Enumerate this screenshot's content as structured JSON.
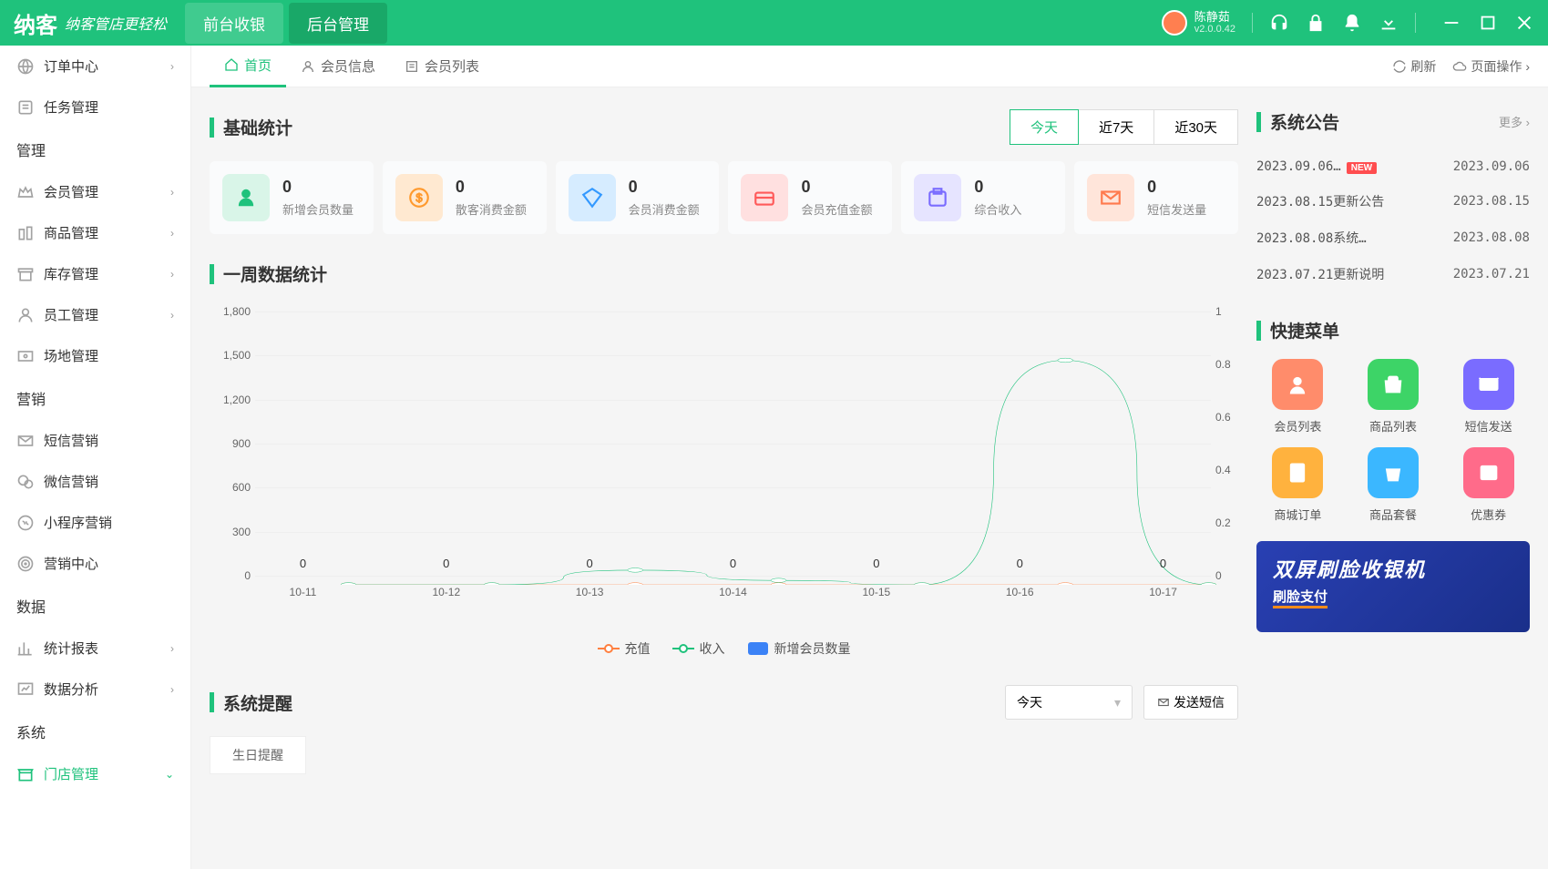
{
  "header": {
    "logo": "纳客",
    "slogan": "纳客管店更轻松",
    "nav1": "前台收银",
    "nav2": "后台管理",
    "user_name": "陈静茹",
    "version": "v2.0.0.42"
  },
  "sidebar": {
    "items": [
      {
        "label": "订单中心",
        "chev": true
      },
      {
        "label": "任务管理"
      }
    ],
    "group1": "管理",
    "items1": [
      {
        "label": "会员管理",
        "chev": true
      },
      {
        "label": "商品管理",
        "chev": true
      },
      {
        "label": "库存管理",
        "chev": true
      },
      {
        "label": "员工管理",
        "chev": true
      },
      {
        "label": "场地管理"
      }
    ],
    "group2": "营销",
    "items2": [
      {
        "label": "短信营销"
      },
      {
        "label": "微信营销"
      },
      {
        "label": "小程序营销"
      },
      {
        "label": "营销中心"
      }
    ],
    "group3": "数据",
    "items3": [
      {
        "label": "统计报表",
        "chev": true
      },
      {
        "label": "数据分析",
        "chev": true
      }
    ],
    "group4": "系统",
    "items4": [
      {
        "label": "门店管理",
        "active": true,
        "chev_down": true
      }
    ]
  },
  "tabs": {
    "home": "首页",
    "member_info": "会员信息",
    "member_list": "会员列表",
    "refresh": "刷新",
    "page_ops": "页面操作"
  },
  "panel1": {
    "title": "基础统计",
    "today": "今天",
    "d7": "近7天",
    "d30": "近30天"
  },
  "stats": [
    {
      "value": "0",
      "label": "新增会员数量",
      "bg": "#d9f5e8",
      "fg": "#1fc27c"
    },
    {
      "value": "0",
      "label": "散客消费金额",
      "bg": "#ffe9d1",
      "fg": "#ff9a2e"
    },
    {
      "value": "0",
      "label": "会员消费金额",
      "bg": "#d6ecff",
      "fg": "#3399ff"
    },
    {
      "value": "0",
      "label": "会员充值金额",
      "bg": "#ffe0e0",
      "fg": "#ff5a5a"
    },
    {
      "value": "0",
      "label": "综合收入",
      "bg": "#e6e4ff",
      "fg": "#7a6cff"
    },
    {
      "value": "0",
      "label": "短信发送量",
      "bg": "#ffe5da",
      "fg": "#ff7a4d"
    }
  ],
  "panel2": {
    "title": "一周数据统计"
  },
  "chart_data": {
    "type": "line",
    "x": [
      "10-11",
      "10-12",
      "10-13",
      "10-14",
      "10-15",
      "10-16",
      "10-17"
    ],
    "series": [
      {
        "name": "充值",
        "values": [
          0,
          0,
          0,
          0,
          0,
          0,
          0
        ],
        "color": "#ff7f3f",
        "axis": "left"
      },
      {
        "name": "收入",
        "values": [
          0,
          0,
          100,
          30,
          0,
          1530,
          0
        ],
        "color": "#1fc27c",
        "axis": "left"
      },
      {
        "name": "新增会员数量",
        "values": [
          0,
          0,
          0,
          0,
          0,
          0,
          0
        ],
        "color": "#3b82f6",
        "axis": "right"
      }
    ],
    "point_labels": [
      "0",
      "0",
      "0",
      "0",
      "0",
      "0",
      "0"
    ],
    "yleft": {
      "min": 0,
      "max": 1800,
      "ticks": [
        0,
        300,
        600,
        900,
        1200,
        1500,
        1800
      ]
    },
    "yright": {
      "min": 0,
      "max": 1,
      "ticks": [
        0,
        0.2,
        0.4,
        0.6,
        0.8,
        1
      ]
    }
  },
  "legend": {
    "l1": "充值",
    "l2": "收入",
    "l3": "新增会员数量"
  },
  "panel3": {
    "title": "系统提醒"
  },
  "reminder": {
    "select": "今天",
    "send_sms": "发送短信",
    "birthday": "生日提醒"
  },
  "notices": {
    "title": "系统公告",
    "more": "更多",
    "items": [
      {
        "title": "2023.09.06…",
        "date": "2023.09.06",
        "new": true
      },
      {
        "title": "2023.08.15更新公告",
        "date": "2023.08.15"
      },
      {
        "title": "2023.08.08系统…",
        "date": "2023.08.08"
      },
      {
        "title": "2023.07.21更新说明",
        "date": "2023.07.21"
      }
    ]
  },
  "quick": {
    "title": "快捷菜单",
    "items": [
      {
        "label": "会员列表",
        "bg": "#ff8c6b"
      },
      {
        "label": "商品列表",
        "bg": "#3dd467"
      },
      {
        "label": "短信发送",
        "bg": "#7a6cff"
      },
      {
        "label": "商城订单",
        "bg": "#ffb23e"
      },
      {
        "label": "商品套餐",
        "bg": "#3bb7ff"
      },
      {
        "label": "优惠券",
        "bg": "#ff6b8a"
      }
    ]
  },
  "ad": {
    "title": "双屏刷脸收银机",
    "sub": "刷脸支付"
  }
}
